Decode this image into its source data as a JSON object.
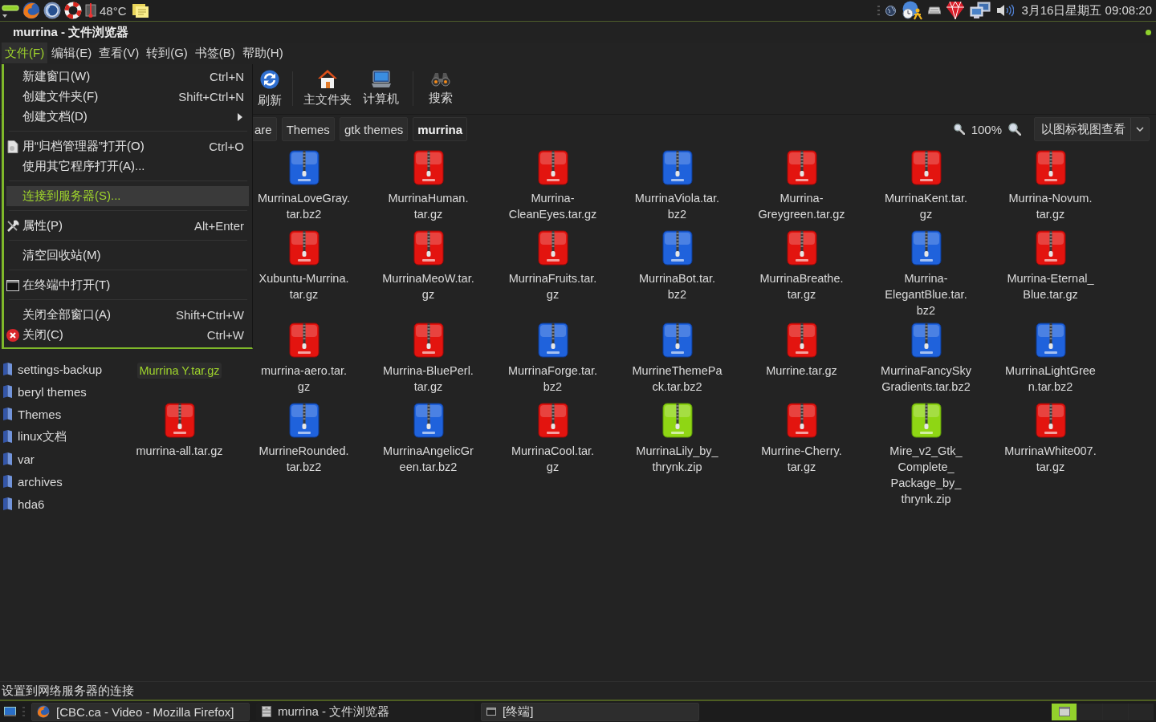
{
  "panel": {
    "temperature": "48°C",
    "clock": "3月16日星期五 09:08:20"
  },
  "window": {
    "title": "murrina - 文件浏览器"
  },
  "menubar": [
    {
      "label": "文件(F)",
      "selected": true
    },
    {
      "label": "编辑(E)",
      "selected": false
    },
    {
      "label": "查看(V)",
      "selected": false
    },
    {
      "label": "转到(G)",
      "selected": false
    },
    {
      "label": "书签(B)",
      "selected": false
    },
    {
      "label": "帮助(H)",
      "selected": false
    }
  ],
  "toolbar": [
    {
      "buttons": [
        {
          "label": "刷新"
        }
      ]
    },
    {
      "buttons": [
        {
          "label": "主文件夹"
        },
        {
          "label": "计算机"
        }
      ]
    },
    {
      "buttons": [
        {
          "label": "搜索"
        }
      ]
    }
  ],
  "pathbar": {
    "buttons": [
      {
        "label": "are",
        "selected": false
      },
      {
        "label": "Themes",
        "selected": false
      },
      {
        "label": "gtk themes",
        "selected": false
      },
      {
        "label": "murrina",
        "selected": true
      }
    ],
    "zoom": "100%",
    "view_mode": "以图标视图查看"
  },
  "sidebar": {
    "items": [
      {
        "label": "settings-backup",
        "selected": false
      },
      {
        "label": "beryl themes",
        "selected": false
      },
      {
        "label": "Themes",
        "selected": false
      },
      {
        "label": "linux文档",
        "selected": false
      },
      {
        "label": "var",
        "selected": false
      },
      {
        "label": "archives",
        "selected": false
      },
      {
        "label": "hda6",
        "selected": false
      }
    ]
  },
  "files": {
    "rows": [
      [
        {
          "name": "MurrinaLoveGray.tar.bz2",
          "kind": "bz2",
          "selected": false
        },
        {
          "name": "MurrinaHuman.tar.gz",
          "kind": "tar",
          "selected": false
        },
        {
          "name": "Murrina-CleanEyes.tar.gz",
          "kind": "tar",
          "selected": false
        },
        {
          "name": "MurrinaViola.tar.bz2",
          "kind": "bz2",
          "selected": false
        },
        {
          "name": "Murrina-Greygreen.tar.gz",
          "kind": "tar",
          "selected": false
        },
        {
          "name": "MurrinaKent.tar.gz",
          "kind": "tar",
          "selected": false
        },
        {
          "name": "Murrina-Novum.tar.gz",
          "kind": "tar",
          "selected": false
        }
      ],
      [
        {
          "name": "Xubuntu-Murrina.tar.gz",
          "kind": "tar",
          "selected": false
        },
        {
          "name": "MurrinaMeoW.tar.gz",
          "kind": "tar",
          "selected": false
        },
        {
          "name": "MurrinaFruits.tar.gz",
          "kind": "tar",
          "selected": false
        },
        {
          "name": "MurrinaBot.tar.bz2",
          "kind": "bz2",
          "selected": false
        },
        {
          "name": "MurrinaBreathe.tar.gz",
          "kind": "tar",
          "selected": false
        },
        {
          "name": "Murrina-ElegantBlue.tar.bz2",
          "kind": "bz2",
          "selected": false
        },
        {
          "name": "Murrina-Eternal_Blue.tar.gz",
          "kind": "tar",
          "selected": false
        }
      ],
      [
        {
          "name": "Murrina Y.tar.gz",
          "selected": true
        },
        {
          "name": "murrina-aero.tar.gz",
          "kind": "tar",
          "selected": false
        },
        {
          "name": "Murrina-BluePerl.tar.gz",
          "kind": "tar",
          "selected": false
        },
        {
          "name": "MurrinaForge.tar.bz2",
          "kind": "bz2",
          "selected": false
        },
        {
          "name": "MurrineThemePack.tar.bz2",
          "kind": "bz2",
          "selected": false
        },
        {
          "name": "Murrine.tar.gz",
          "kind": "tar",
          "selected": false
        },
        {
          "name": "MurrinaFancySkyGradients.tar.bz2",
          "kind": "bz2",
          "selected": false
        },
        {
          "name": "MurrinaLightGreen.tar.bz2",
          "kind": "bz2",
          "selected": false
        }
      ],
      [
        {
          "name": "murrina-all.tar.gz",
          "kind": "tar",
          "selected": false
        },
        {
          "name": "MurrineRounded.tar.bz2",
          "kind": "bz2",
          "selected": false
        },
        {
          "name": "MurrinaAngelicGreen.tar.bz2",
          "kind": "bz2",
          "selected": false
        },
        {
          "name": "MurrinaCool.tar.gz",
          "kind": "tar",
          "selected": false
        },
        {
          "name": "MurrinaLily_by_thrynk.zip",
          "kind": "zip",
          "selected": false
        },
        {
          "name": "Murrine-Cherry.tar.gz",
          "kind": "tar",
          "selected": false
        },
        {
          "name": "Mire_v2_Gtk_Complete_Package_by_thrynk.zip",
          "kind": "zip",
          "selected": false
        },
        {
          "name": "MurrinaWhite007.tar.gz",
          "kind": "tar",
          "selected": false
        }
      ]
    ]
  },
  "file_menu": {
    "sections": [
      {
        "items": [
          {
            "label": "新建窗口(W)",
            "shortcut": "Ctrl+N",
            "submenu": false,
            "selected": false
          },
          {
            "label": "创建文件夹(F)",
            "shortcut": "Shift+Ctrl+N",
            "submenu": false,
            "selected": false
          },
          {
            "label": "创建文档(D)",
            "submenu": true,
            "selected": false
          }
        ]
      },
      {
        "items": [
          {
            "label": "用“归档管理器”打开(O)",
            "shortcut": "Ctrl+O",
            "submenu": false,
            "selected": false
          },
          {
            "label": "使用其它程序打开(A)...",
            "submenu": false,
            "selected": false
          }
        ]
      },
      {
        "items": [
          {
            "label": "连接到服务器(S)...",
            "submenu": false,
            "selected": true
          }
        ]
      },
      {
        "items": [
          {
            "label": "属性(P)",
            "shortcut": "Alt+Enter",
            "submenu": false,
            "selected": false
          }
        ]
      },
      {
        "items": [
          {
            "label": "清空回收站(M)",
            "submenu": false,
            "selected": false
          }
        ]
      },
      {
        "items": [
          {
            "label": "在终端中打开(T)",
            "submenu": false,
            "selected": false
          }
        ]
      },
      {
        "items": [
          {
            "label": "关闭全部窗口(A)",
            "shortcut": "Shift+Ctrl+W",
            "submenu": false,
            "selected": false
          },
          {
            "label": "关闭(C)",
            "shortcut": "Ctrl+W",
            "submenu": false,
            "selected": false
          }
        ]
      }
    ]
  },
  "status_bar": "设置到网络服务器的连接",
  "taskbar": {
    "tasks": [
      {
        "label": "[CBC.ca - Video - Mozilla Firefox]",
        "selected": false
      },
      {
        "label": "murrina - 文件浏览器",
        "selected": true
      },
      {
        "label": "[终端]",
        "selected": false
      }
    ],
    "workspaces": [
      {
        "selected": true
      },
      {
        "selected": false
      },
      {
        "selected": false
      },
      {
        "selected": false
      }
    ]
  }
}
